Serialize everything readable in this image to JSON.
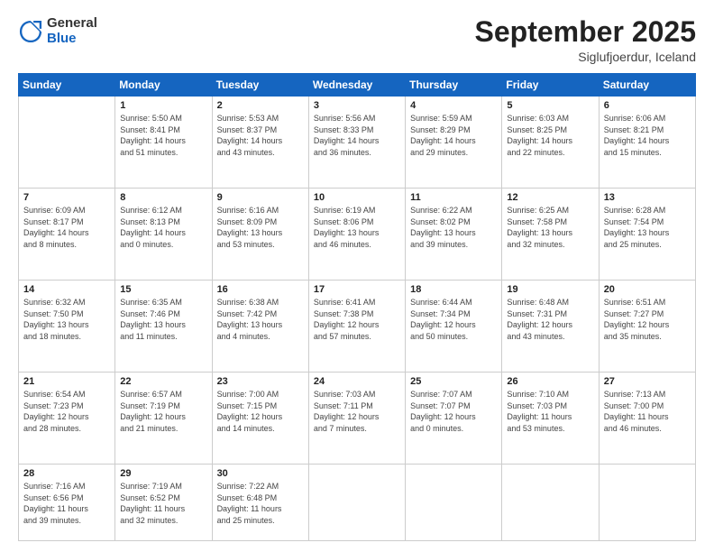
{
  "logo": {
    "general": "General",
    "blue": "Blue"
  },
  "header": {
    "month": "September 2025",
    "location": "Siglufjoerdur, Iceland"
  },
  "weekdays": [
    "Sunday",
    "Monday",
    "Tuesday",
    "Wednesday",
    "Thursday",
    "Friday",
    "Saturday"
  ],
  "weeks": [
    [
      {
        "day": "",
        "info": ""
      },
      {
        "day": "1",
        "info": "Sunrise: 5:50 AM\nSunset: 8:41 PM\nDaylight: 14 hours\nand 51 minutes."
      },
      {
        "day": "2",
        "info": "Sunrise: 5:53 AM\nSunset: 8:37 PM\nDaylight: 14 hours\nand 43 minutes."
      },
      {
        "day": "3",
        "info": "Sunrise: 5:56 AM\nSunset: 8:33 PM\nDaylight: 14 hours\nand 36 minutes."
      },
      {
        "day": "4",
        "info": "Sunrise: 5:59 AM\nSunset: 8:29 PM\nDaylight: 14 hours\nand 29 minutes."
      },
      {
        "day": "5",
        "info": "Sunrise: 6:03 AM\nSunset: 8:25 PM\nDaylight: 14 hours\nand 22 minutes."
      },
      {
        "day": "6",
        "info": "Sunrise: 6:06 AM\nSunset: 8:21 PM\nDaylight: 14 hours\nand 15 minutes."
      }
    ],
    [
      {
        "day": "7",
        "info": "Sunrise: 6:09 AM\nSunset: 8:17 PM\nDaylight: 14 hours\nand 8 minutes."
      },
      {
        "day": "8",
        "info": "Sunrise: 6:12 AM\nSunset: 8:13 PM\nDaylight: 14 hours\nand 0 minutes."
      },
      {
        "day": "9",
        "info": "Sunrise: 6:16 AM\nSunset: 8:09 PM\nDaylight: 13 hours\nand 53 minutes."
      },
      {
        "day": "10",
        "info": "Sunrise: 6:19 AM\nSunset: 8:06 PM\nDaylight: 13 hours\nand 46 minutes."
      },
      {
        "day": "11",
        "info": "Sunrise: 6:22 AM\nSunset: 8:02 PM\nDaylight: 13 hours\nand 39 minutes."
      },
      {
        "day": "12",
        "info": "Sunrise: 6:25 AM\nSunset: 7:58 PM\nDaylight: 13 hours\nand 32 minutes."
      },
      {
        "day": "13",
        "info": "Sunrise: 6:28 AM\nSunset: 7:54 PM\nDaylight: 13 hours\nand 25 minutes."
      }
    ],
    [
      {
        "day": "14",
        "info": "Sunrise: 6:32 AM\nSunset: 7:50 PM\nDaylight: 13 hours\nand 18 minutes."
      },
      {
        "day": "15",
        "info": "Sunrise: 6:35 AM\nSunset: 7:46 PM\nDaylight: 13 hours\nand 11 minutes."
      },
      {
        "day": "16",
        "info": "Sunrise: 6:38 AM\nSunset: 7:42 PM\nDaylight: 13 hours\nand 4 minutes."
      },
      {
        "day": "17",
        "info": "Sunrise: 6:41 AM\nSunset: 7:38 PM\nDaylight: 12 hours\nand 57 minutes."
      },
      {
        "day": "18",
        "info": "Sunrise: 6:44 AM\nSunset: 7:34 PM\nDaylight: 12 hours\nand 50 minutes."
      },
      {
        "day": "19",
        "info": "Sunrise: 6:48 AM\nSunset: 7:31 PM\nDaylight: 12 hours\nand 43 minutes."
      },
      {
        "day": "20",
        "info": "Sunrise: 6:51 AM\nSunset: 7:27 PM\nDaylight: 12 hours\nand 35 minutes."
      }
    ],
    [
      {
        "day": "21",
        "info": "Sunrise: 6:54 AM\nSunset: 7:23 PM\nDaylight: 12 hours\nand 28 minutes."
      },
      {
        "day": "22",
        "info": "Sunrise: 6:57 AM\nSunset: 7:19 PM\nDaylight: 12 hours\nand 21 minutes."
      },
      {
        "day": "23",
        "info": "Sunrise: 7:00 AM\nSunset: 7:15 PM\nDaylight: 12 hours\nand 14 minutes."
      },
      {
        "day": "24",
        "info": "Sunrise: 7:03 AM\nSunset: 7:11 PM\nDaylight: 12 hours\nand 7 minutes."
      },
      {
        "day": "25",
        "info": "Sunrise: 7:07 AM\nSunset: 7:07 PM\nDaylight: 12 hours\nand 0 minutes."
      },
      {
        "day": "26",
        "info": "Sunrise: 7:10 AM\nSunset: 7:03 PM\nDaylight: 11 hours\nand 53 minutes."
      },
      {
        "day": "27",
        "info": "Sunrise: 7:13 AM\nSunset: 7:00 PM\nDaylight: 11 hours\nand 46 minutes."
      }
    ],
    [
      {
        "day": "28",
        "info": "Sunrise: 7:16 AM\nSunset: 6:56 PM\nDaylight: 11 hours\nand 39 minutes."
      },
      {
        "day": "29",
        "info": "Sunrise: 7:19 AM\nSunset: 6:52 PM\nDaylight: 11 hours\nand 32 minutes."
      },
      {
        "day": "30",
        "info": "Sunrise: 7:22 AM\nSunset: 6:48 PM\nDaylight: 11 hours\nand 25 minutes."
      },
      {
        "day": "",
        "info": ""
      },
      {
        "day": "",
        "info": ""
      },
      {
        "day": "",
        "info": ""
      },
      {
        "day": "",
        "info": ""
      }
    ]
  ]
}
